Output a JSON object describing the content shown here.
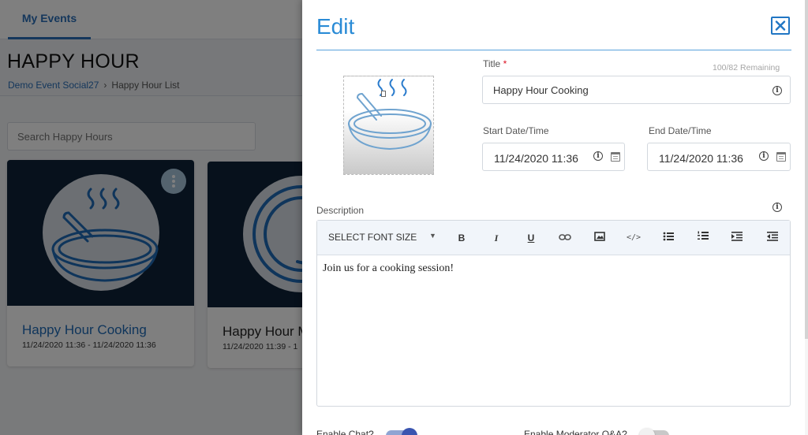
{
  "nav": {
    "tab_label": "My Events"
  },
  "page": {
    "title": "HAPPY HOUR",
    "breadcrumb": {
      "parent": "Demo Event Social27",
      "separator": "›",
      "current": "Happy Hour List"
    }
  },
  "search": {
    "placeholder": "Search Happy Hours"
  },
  "cards": [
    {
      "name": "Happy Hour Cooking",
      "dates": "11/24/2020 11:36 - 11/24/2020 11:36"
    },
    {
      "name": "Happy Hour M",
      "dates": "11/24/2020 11:39 - 1"
    }
  ],
  "drawer": {
    "title": "Edit",
    "title_field": {
      "label": "Title",
      "required_mark": "*",
      "remaining": "100/82 Remaining",
      "value": "Happy Hour Cooking"
    },
    "start": {
      "label": "Start Date/Time",
      "value": "11/24/2020 11:36"
    },
    "end": {
      "label": "End Date/Time",
      "value": "11/24/2020 11:36"
    },
    "description": {
      "label": "Description",
      "font_size_select": "SELECT FONT SIZE",
      "content": "Join us for a cooking session!"
    },
    "toggles": [
      {
        "label": "Enable Chat?",
        "on": true
      },
      {
        "label": "Enable Moderator Q&A?",
        "on": false
      }
    ]
  },
  "colors": {
    "accent": "#2a8bd6",
    "link": "#2a6fb8",
    "card_bg": "#0e2238"
  },
  "icons": [
    "frying-pan-icon",
    "close-icon",
    "info-icon",
    "calendar-icon",
    "more-vertical-icon"
  ]
}
